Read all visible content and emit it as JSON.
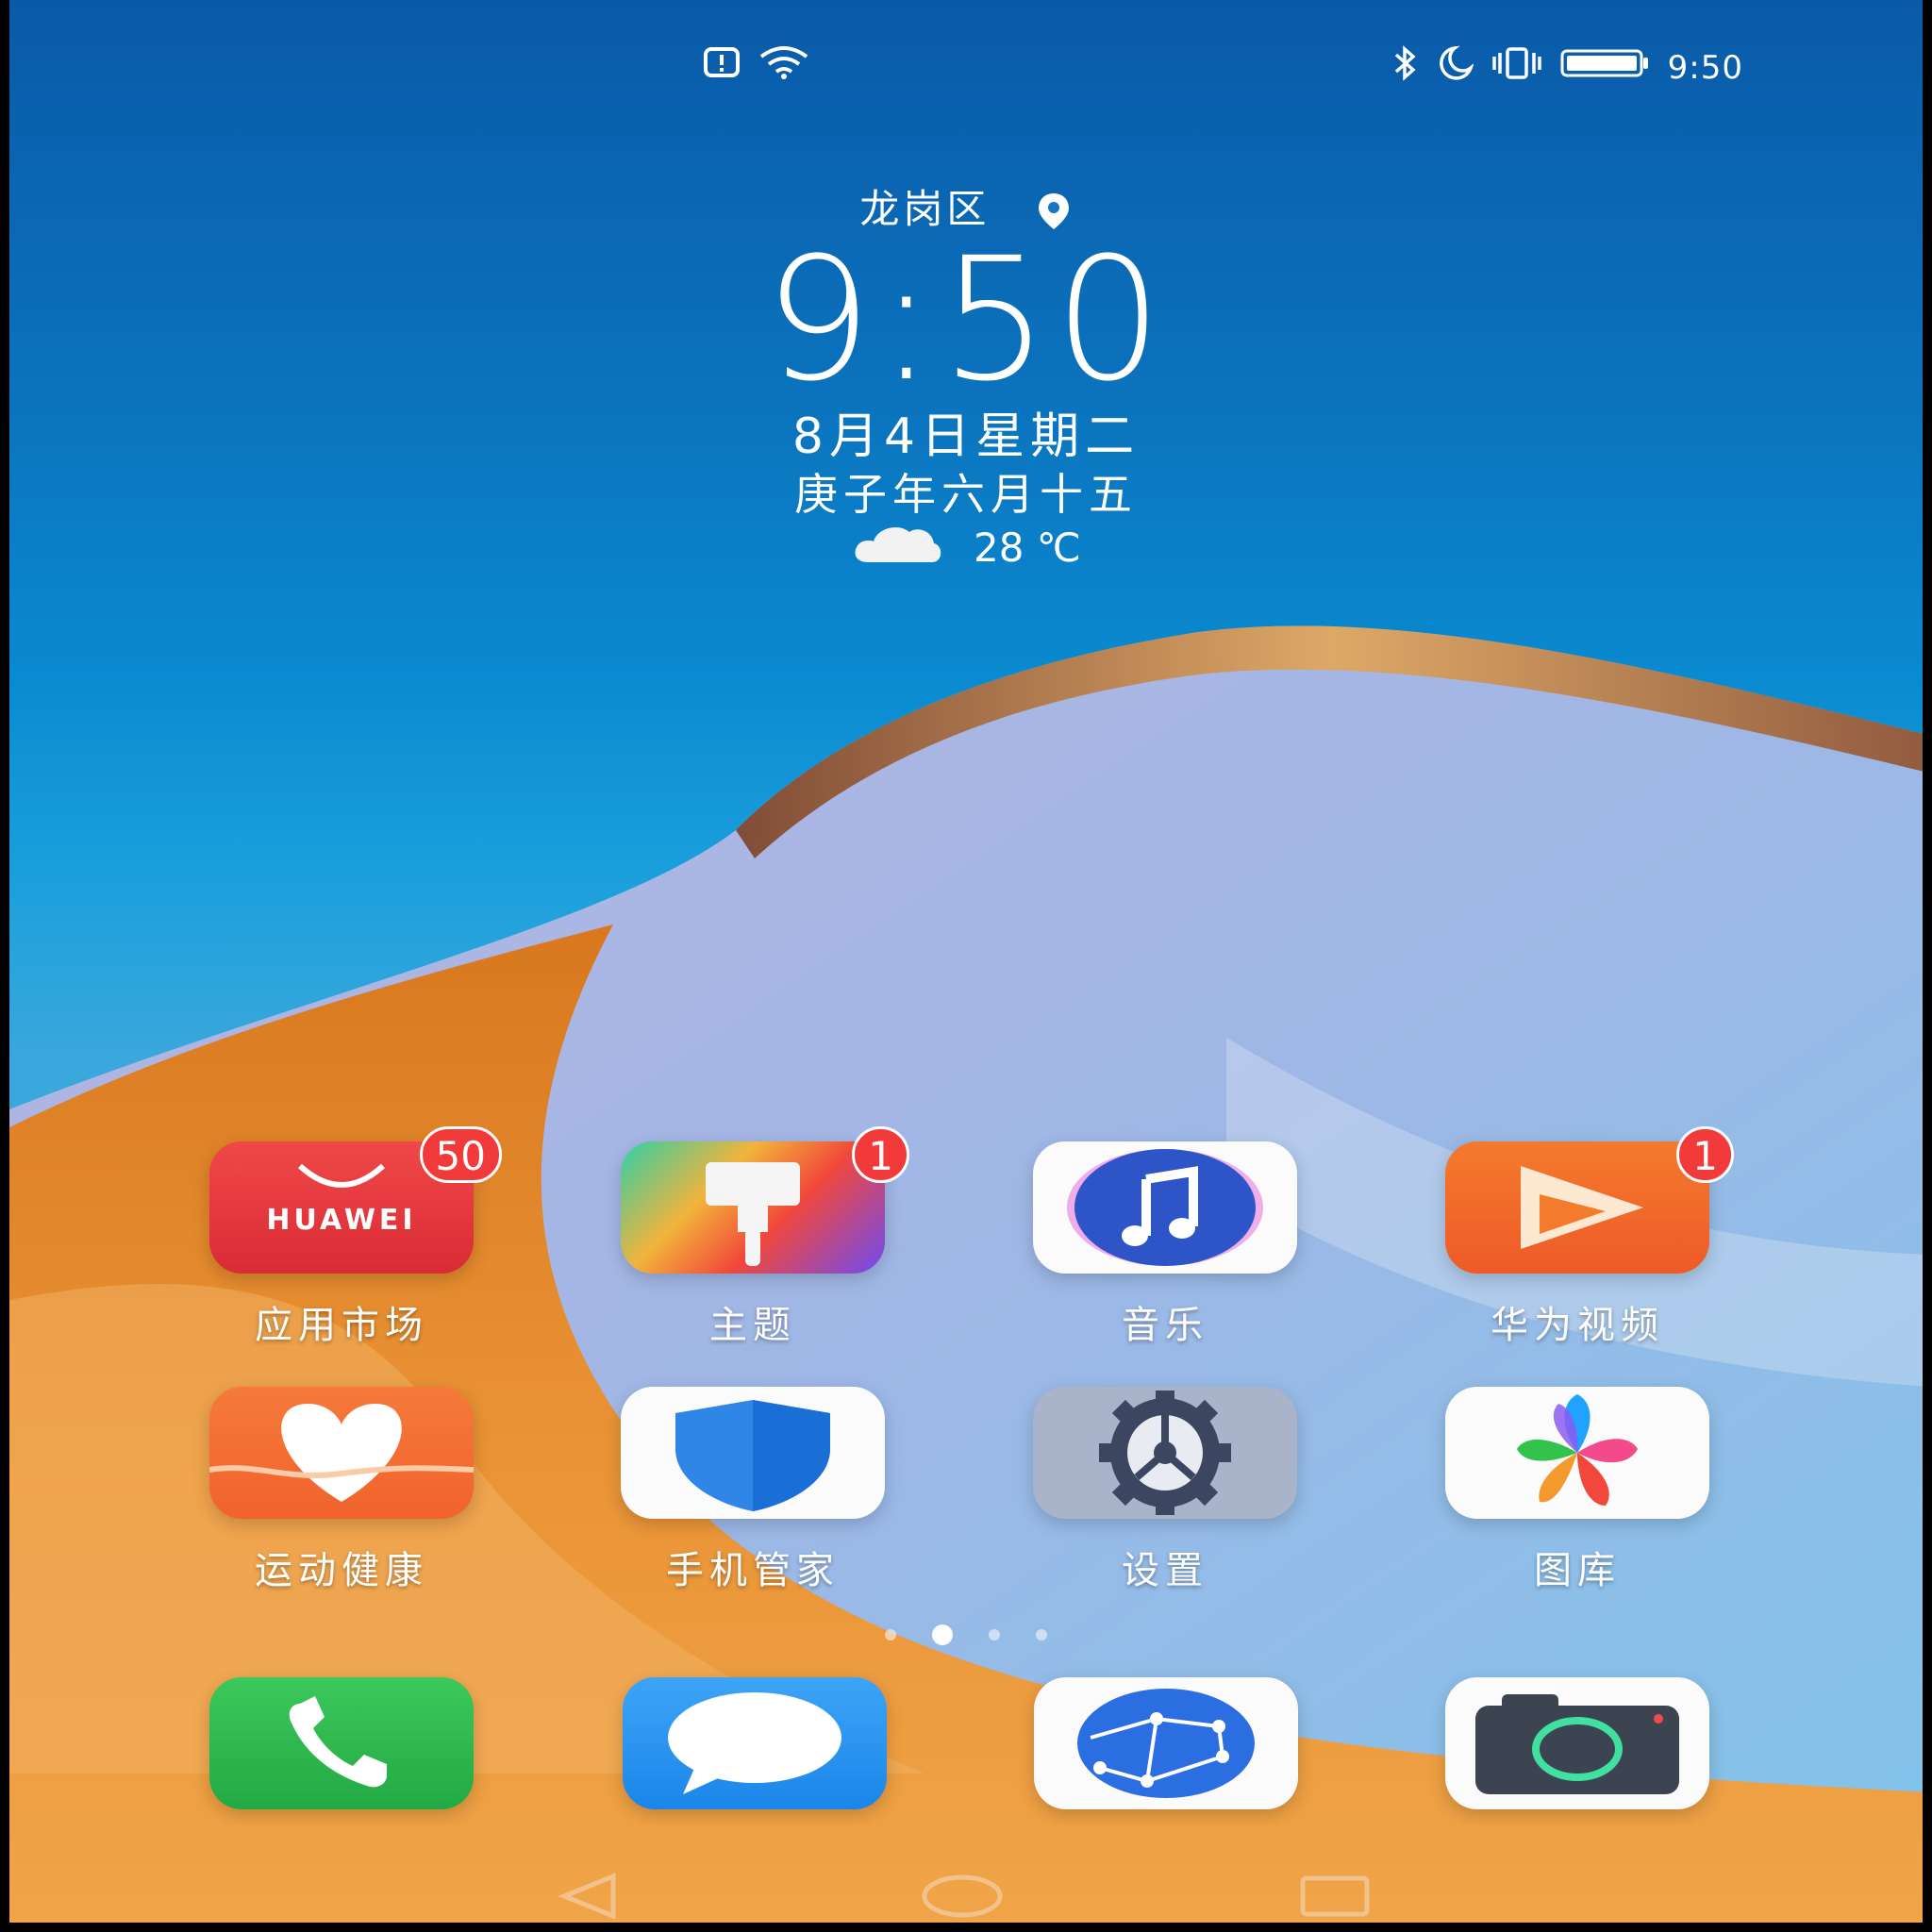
{
  "status_bar": {
    "time": "9:50",
    "left_icons": [
      "alert-box-icon",
      "wifi-icon"
    ],
    "right_icons": [
      "bluetooth-icon",
      "do-not-disturb-moon-icon",
      "vibrate-icon",
      "battery-icon"
    ]
  },
  "lockscreen": {
    "location": "龙岗区",
    "clock": "9:50",
    "date": "8月4日星期二",
    "lunar_date": "庚子年六月十五",
    "temperature": "28 ℃",
    "weather_icon": "cloud-icon"
  },
  "apps": [
    {
      "label": "应用市场",
      "icon": "huawei-appgallery-icon",
      "badge": "50",
      "brand": "HUAWEI"
    },
    {
      "label": "主题",
      "icon": "paintbrush-icon",
      "badge": "1"
    },
    {
      "label": "音乐",
      "icon": "music-note-icon",
      "badge": ""
    },
    {
      "label": "华为视频",
      "icon": "play-icon",
      "badge": "1"
    },
    {
      "label": "运动健康",
      "icon": "heart-icon",
      "badge": ""
    },
    {
      "label": "手机管家",
      "icon": "shield-icon",
      "badge": ""
    },
    {
      "label": "设置",
      "icon": "gear-icon",
      "badge": ""
    },
    {
      "label": "图库",
      "icon": "pinwheel-icon",
      "badge": ""
    }
  ],
  "page_indicator": {
    "count": 4,
    "active_index": 1
  },
  "dock": [
    {
      "icon": "phone-icon"
    },
    {
      "icon": "message-bubble-icon"
    },
    {
      "icon": "browser-globe-icon"
    },
    {
      "icon": "camera-icon"
    }
  ],
  "navigation": {
    "buttons": [
      "back-icon",
      "home-icon",
      "recents-icon"
    ]
  },
  "colors": {
    "sky_top": "#0a5aa8",
    "wave_orange": "#e8892a",
    "badge_red": "#f23a3a"
  }
}
